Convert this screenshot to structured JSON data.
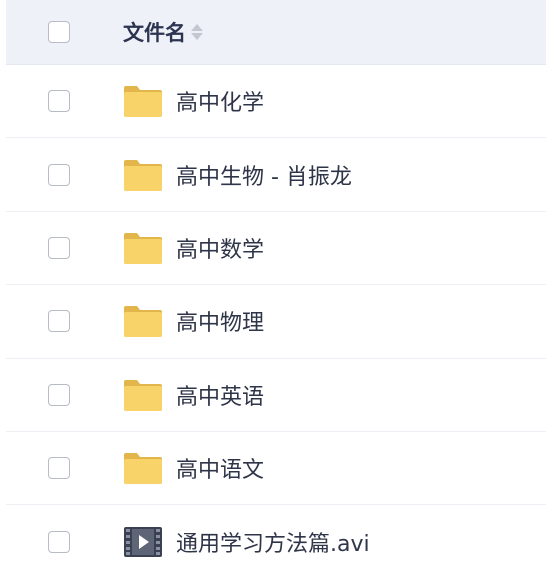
{
  "header": {
    "name_label": "文件名",
    "sort_icon": "sort-icon"
  },
  "files": [
    {
      "name": "高中化学",
      "type": "folder",
      "icon": "folder-icon"
    },
    {
      "name": "高中生物 - 肖振龙",
      "type": "folder",
      "icon": "folder-icon"
    },
    {
      "name": "高中数学",
      "type": "folder",
      "icon": "folder-icon"
    },
    {
      "name": "高中物理",
      "type": "folder",
      "icon": "folder-icon"
    },
    {
      "name": "高中英语",
      "type": "folder",
      "icon": "folder-icon"
    },
    {
      "name": "高中语文",
      "type": "folder",
      "icon": "folder-icon"
    },
    {
      "name": "通用学习方法篇.avi",
      "type": "video",
      "icon": "video-file-icon"
    }
  ],
  "colors": {
    "header_bg": "#eef1f8",
    "folder": "#f5cc5c",
    "folder_dark": "#e2b64a",
    "text": "#2f3548"
  }
}
